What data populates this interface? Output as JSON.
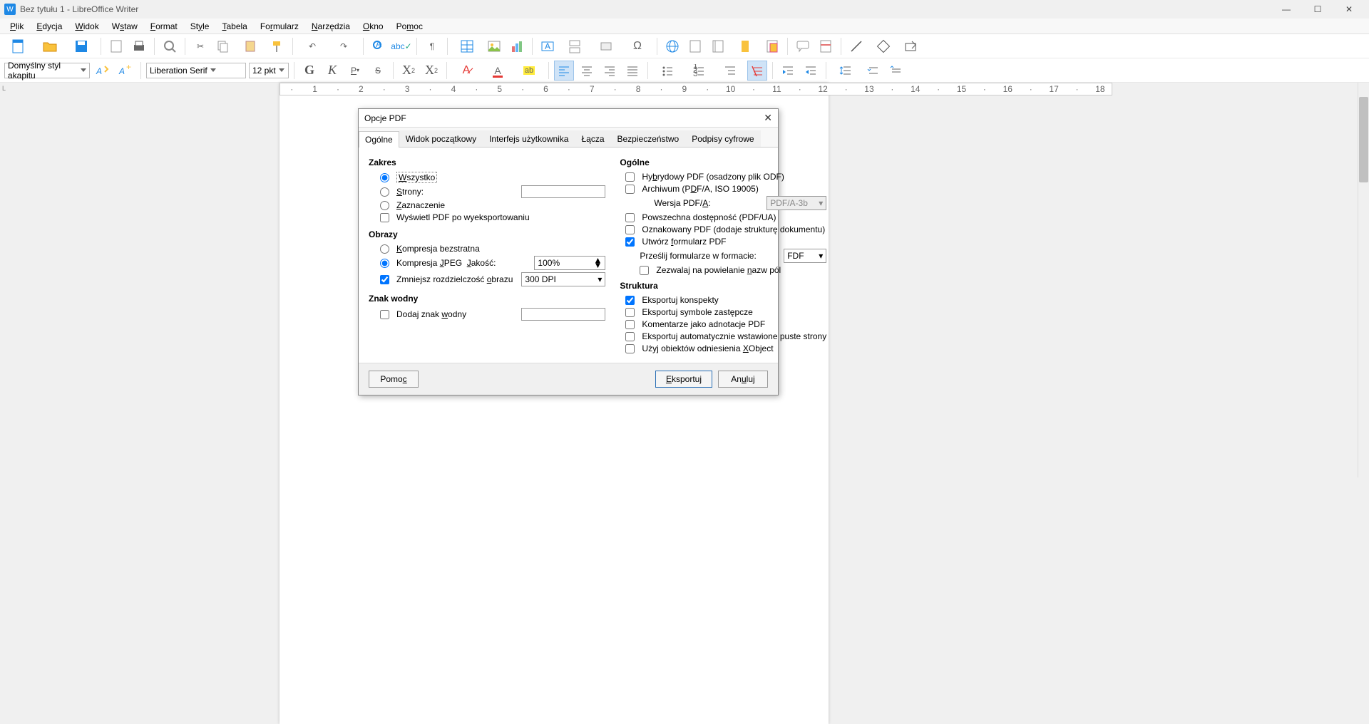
{
  "window": {
    "title": "Bez tytułu 1 - LibreOffice Writer"
  },
  "menu": {
    "file": "Plik",
    "edit": "Edycja",
    "view": "Widok",
    "insert": "Wstaw",
    "format": "Format",
    "styles": "Style",
    "table": "Tabela",
    "form": "Formularz",
    "tools": "Narzędzia",
    "window": "Okno",
    "help": "Pomoc"
  },
  "toolbar2": {
    "parastyle": "Domyślny styl akapitu",
    "font": "Liberation Serif",
    "size": "12 pkt"
  },
  "ruler": [
    "1",
    "2",
    "3",
    "4",
    "5",
    "6",
    "7",
    "8",
    "9",
    "10",
    "11",
    "12",
    "13",
    "14",
    "15",
    "16",
    "17",
    "18"
  ],
  "dialog": {
    "title": "Opcje PDF",
    "tabs": {
      "general": "Ogólne",
      "initview": "Widok początkowy",
      "ui": "Interfejs użytkownika",
      "links": "Łącza",
      "security": "Bezpieczeństwo",
      "sign": "Podpisy cyfrowe"
    },
    "range": {
      "title": "Zakres",
      "all": "Wszystko",
      "pages": "Strony:",
      "selection": "Zaznaczenie",
      "viewafter": "Wyświetl PDF po wyeksportowaniu"
    },
    "images": {
      "title": "Obrazy",
      "lossless": "Kompresja bezstratna",
      "jpeg": "Kompresja JPEG  Jakość:",
      "jpegq": "100%",
      "reduce": "Zmniejsz rozdzielczość obrazu",
      "dpi": "300 DPI"
    },
    "watermark": {
      "title": "Znak wodny",
      "add": "Dodaj znak wodny"
    },
    "general": {
      "title": "Ogólne",
      "hybrid": "Hybrydowy PDF (osadzony plik ODF)",
      "archive": "Archiwum (PDF/A, ISO 19005)",
      "pdfaver_lbl": "Wersja PDF/A:",
      "pdfaver": "PDF/A-3b",
      "ua": "Powszechna dostępność (PDF/UA)",
      "tagged": "Oznakowany PDF (dodaje strukturę dokumentu)",
      "form": "Utwórz formularz PDF",
      "submit_lbl": "Prześlij formularze w formacie:",
      "submit": "FDF",
      "dupnames": "Zezwalaj na powielanie nazw pól"
    },
    "structure": {
      "title": "Struktura",
      "outlines": "Eksportuj konspekty",
      "placeholders": "Eksportuj symbole zastępcze",
      "comments": "Komentarze jako adnotacje PDF",
      "blank": "Eksportuj automatycznie wstawione puste strony",
      "xobj": "Użyj obiektów odniesienia XObject"
    },
    "buttons": {
      "help": "Pomoc",
      "export": "Eksportuj",
      "cancel": "Anuluj"
    }
  }
}
